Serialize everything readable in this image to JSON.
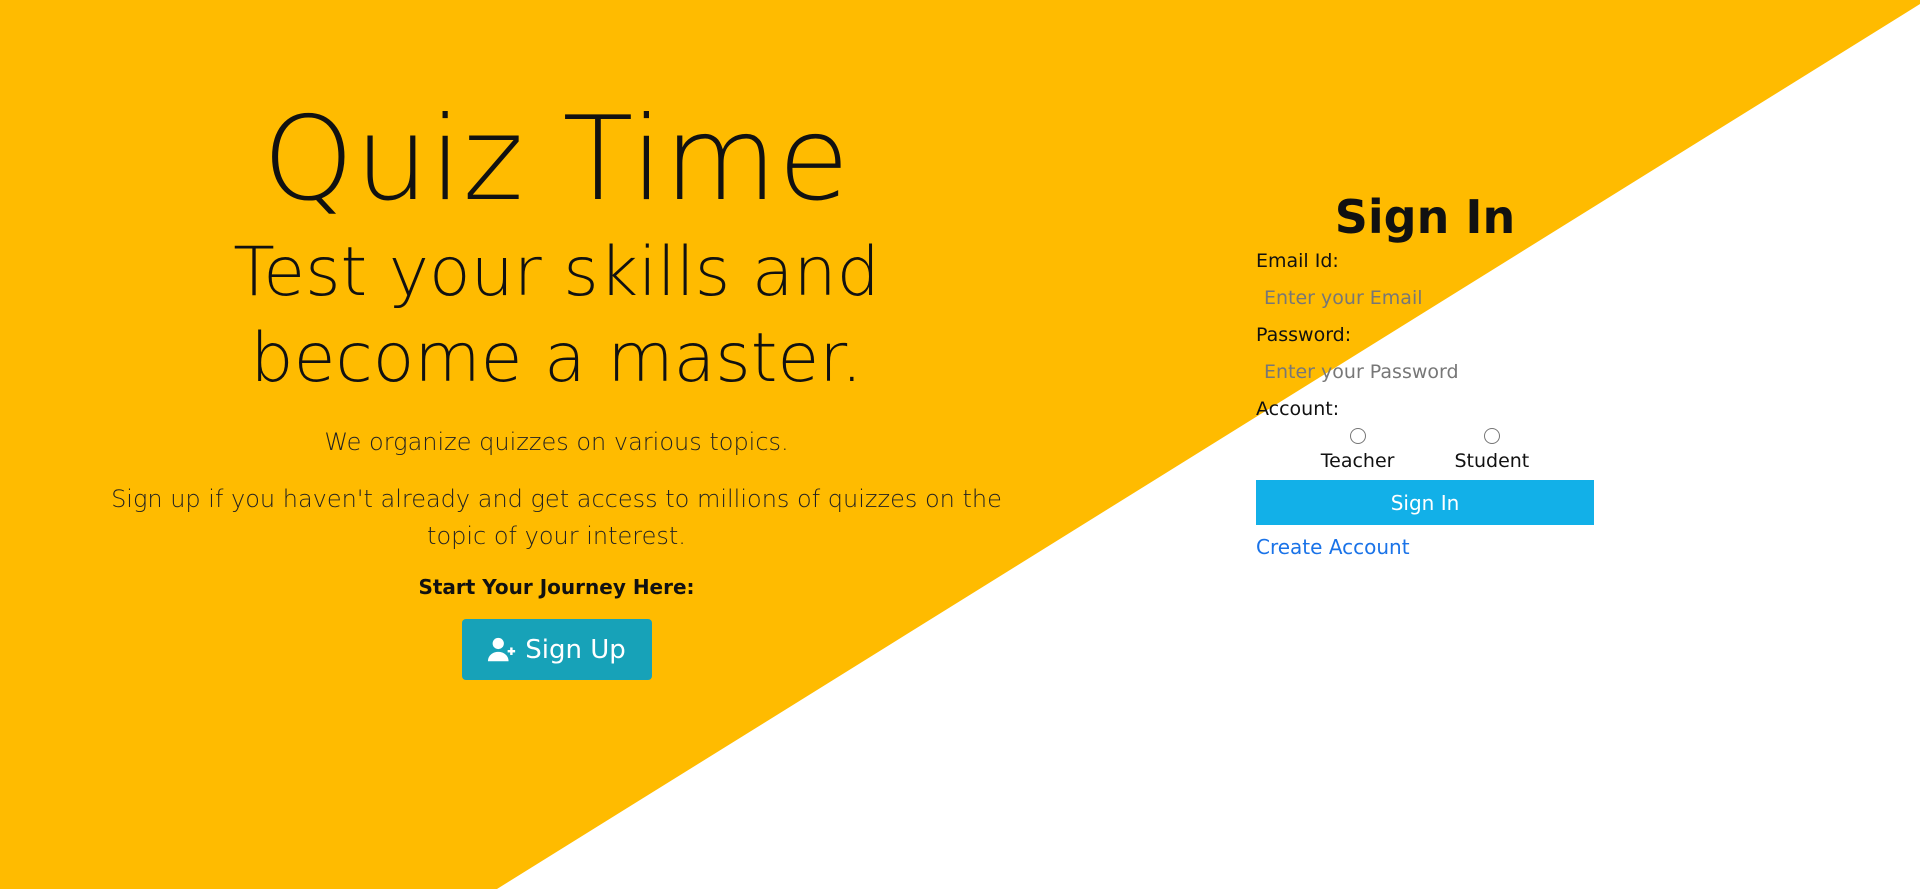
{
  "colors": {
    "accent_yellow": "#ffbb00",
    "signup_button": "#17a2b8",
    "signin_button": "#12b0e8",
    "link": "#1a73e8"
  },
  "hero": {
    "title": "Quiz Time",
    "subtitle": "Test your skills and become a master.",
    "text1": "We organize quizzes on various topics.",
    "text2": "Sign up if you haven't already and get access to millions of quizzes on the topic of your interest.",
    "cta_label": "Start Your Journey Here:",
    "signup_icon": "user-plus-icon",
    "signup_label": "Sign Up"
  },
  "signin": {
    "title": "Sign In",
    "email_label": "Email Id:",
    "email_placeholder": "Enter your Email",
    "password_label": "Password:",
    "password_placeholder": "Enter your Password",
    "account_label": "Account:",
    "account_options": [
      "Teacher",
      "Student"
    ],
    "submit_label": "Sign In",
    "create_account_label": "Create Account"
  }
}
